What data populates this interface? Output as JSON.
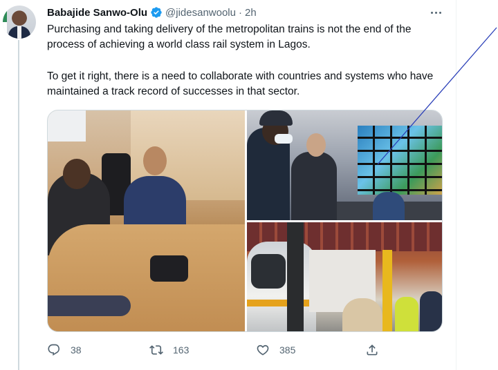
{
  "tweet": {
    "author_name": "Babajide Sanwo-Olu",
    "handle": "@jidesanwoolu",
    "separator": "·",
    "time": "2h",
    "paragraph_1": "Purchasing and taking delivery of the metropolitan trains is not the end of the process of achieving a world class rail system in Lagos.",
    "paragraph_2": "To get it right, there is a need to collaborate with countries and systems who have maintained a track record of successes in that sector."
  },
  "actions": {
    "replies": "38",
    "retweets": "163",
    "likes": "385"
  },
  "colors": {
    "verified_badge": "#1d9bf0",
    "secondary_text": "#536471",
    "annotation_line": "#2a3fb8"
  },
  "icons": [
    "avatar",
    "verified-badge-icon",
    "more-icon",
    "reply-icon",
    "retweet-icon",
    "like-icon",
    "share-icon"
  ]
}
